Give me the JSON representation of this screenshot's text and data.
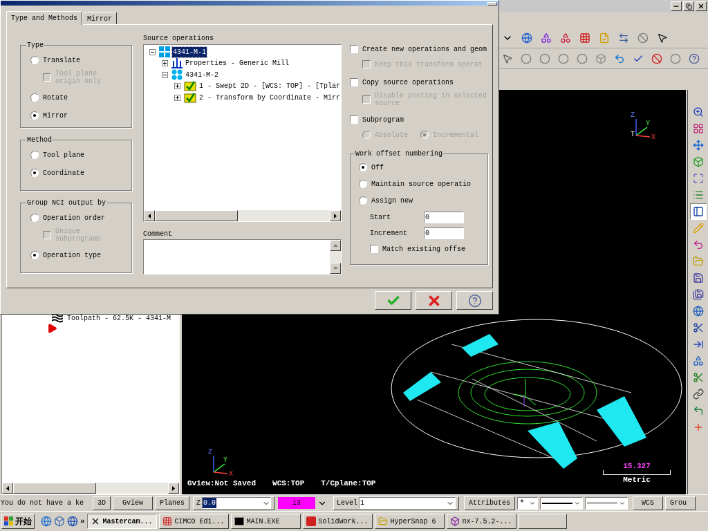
{
  "dialog": {
    "tabs": [
      {
        "label": "Type and Methods",
        "selected": true
      },
      {
        "label": "Mirror",
        "selected": false
      }
    ],
    "groups": [
      {
        "title": "Type",
        "options": [
          {
            "kind": "radio",
            "label": "Translate",
            "selected": false,
            "disabled": false,
            "children": [
              {
                "kind": "checkbox",
                "label": "Tool plane origin only",
                "checked": false,
                "disabled": true
              }
            ]
          },
          {
            "kind": "radio",
            "label": "Rotate",
            "selected": false,
            "disabled": false
          },
          {
            "kind": "radio",
            "label": "Mirror",
            "selected": true,
            "disabled": false
          }
        ]
      },
      {
        "title": "Method",
        "options": [
          {
            "kind": "radio",
            "label": "Tool plane",
            "selected": false,
            "disabled": false
          },
          {
            "kind": "radio",
            "label": "Coordinate",
            "selected": true,
            "disabled": false
          }
        ]
      },
      {
        "title": "Group NCI output by",
        "options": [
          {
            "kind": "radio",
            "label": "Operation order",
            "selected": false,
            "disabled": false,
            "children": [
              {
                "kind": "checkbox",
                "label": "Unique subprograms",
                "checked": false,
                "disabled": true
              }
            ]
          },
          {
            "kind": "radio",
            "label": "Operation type",
            "selected": true,
            "disabled": false
          }
        ]
      }
    ],
    "source_operations": {
      "label": "Source operations",
      "tree": [
        {
          "label": "4341-M-1",
          "kind": "machine_group",
          "selected": true,
          "expanded": true,
          "children": [
            {
              "label": "Properties - Generic Mill",
              "kind": "properties",
              "selected": false,
              "expanded": false
            },
            {
              "label": "4341-M-2",
              "kind": "toolpath_group",
              "selected": false,
              "expanded": true,
              "children": [
                {
                  "label": "1 - Swept 2D - [WCS: TOP] - [Tplar",
                  "kind": "operation",
                  "selected": false,
                  "expanded": false
                },
                {
                  "label": "2 - Transform by Coordinate - Mirr",
                  "kind": "operation",
                  "selected": false,
                  "expanded": false
                }
              ]
            }
          ]
        }
      ]
    },
    "comment": {
      "label": "Comment"
    },
    "options": [
      {
        "kind": "checkbox",
        "label": "Create new operations and geom",
        "checked": false,
        "disabled": false,
        "children": [
          {
            "kind": "checkbox",
            "label": "Keep this transform operat",
            "checked": false,
            "disabled": true
          }
        ]
      },
      {
        "kind": "checkbox",
        "label": "Copy source operations",
        "checked": false,
        "disabled": false,
        "children": [
          {
            "kind": "checkbox",
            "label": "Disable posting in selected source",
            "checked": false,
            "disabled": true
          }
        ]
      },
      {
        "kind": "checkbox",
        "label": "Subprogram",
        "checked": false,
        "disabled": false,
        "children": [
          {
            "kind": "radio",
            "label": "Absolute",
            "selected": false,
            "disabled": true
          },
          {
            "kind": "radio",
            "label": "Incremental",
            "selected": true,
            "disabled": true
          }
        ]
      }
    ],
    "work_offset": {
      "title": "Work offset numbering",
      "options": [
        {
          "kind": "radio",
          "label": "Off",
          "selected": true,
          "disabled": false
        },
        {
          "kind": "radio",
          "label": "Maintain source operatio",
          "selected": false,
          "disabled": false
        },
        {
          "kind": "radio",
          "label": "Assign new",
          "selected": false,
          "disabled": false
        }
      ],
      "fields": [
        {
          "label": "Start",
          "value": "0"
        },
        {
          "label": "Increment",
          "value": "0"
        }
      ],
      "match": {
        "kind": "checkbox",
        "label": "Match existing offse",
        "checked": false,
        "disabled": false
      }
    }
  },
  "operations_tree": [
    {
      "label": "Toolpath - 62.5K - 4341-M"
    }
  ],
  "viewport": {
    "top_triad": {
      "z": "Z",
      "y": "Y",
      "origin": "T",
      "x": "X"
    },
    "bottom_triad": {
      "z": "Z",
      "y": "Y",
      "x": "X"
    },
    "info": [
      "Gview:Not Saved",
      "WCS:TOP",
      "T/Cplane:TOP"
    ],
    "scale": {
      "value": "15.327",
      "unit": "Metric"
    }
  },
  "status_bar": {
    "message": "You do not have a ke",
    "buttons": [
      "3D",
      "Gview",
      "Planes"
    ],
    "z": {
      "label": "Z",
      "value": "0.0"
    },
    "color": {
      "value": "13",
      "color": "#ff00ff"
    },
    "level": {
      "label": "Level",
      "value": "1"
    },
    "attributes": "Attributes",
    "point_style": "*",
    "wcs": "WCS",
    "groups": "Grou"
  },
  "taskbar": {
    "start": "开始",
    "more": "»",
    "items": [
      {
        "label": "Mastercam...",
        "selected": true
      },
      {
        "label": "CIMCO Edi...",
        "selected": false
      },
      {
        "label": "MAIN.EXE",
        "selected": false
      },
      {
        "label": "SolidWork...",
        "selected": false
      },
      {
        "label": "HyperSnap 6",
        "selected": false
      },
      {
        "label": "nx-7.5.2-...",
        "selected": false
      }
    ]
  }
}
